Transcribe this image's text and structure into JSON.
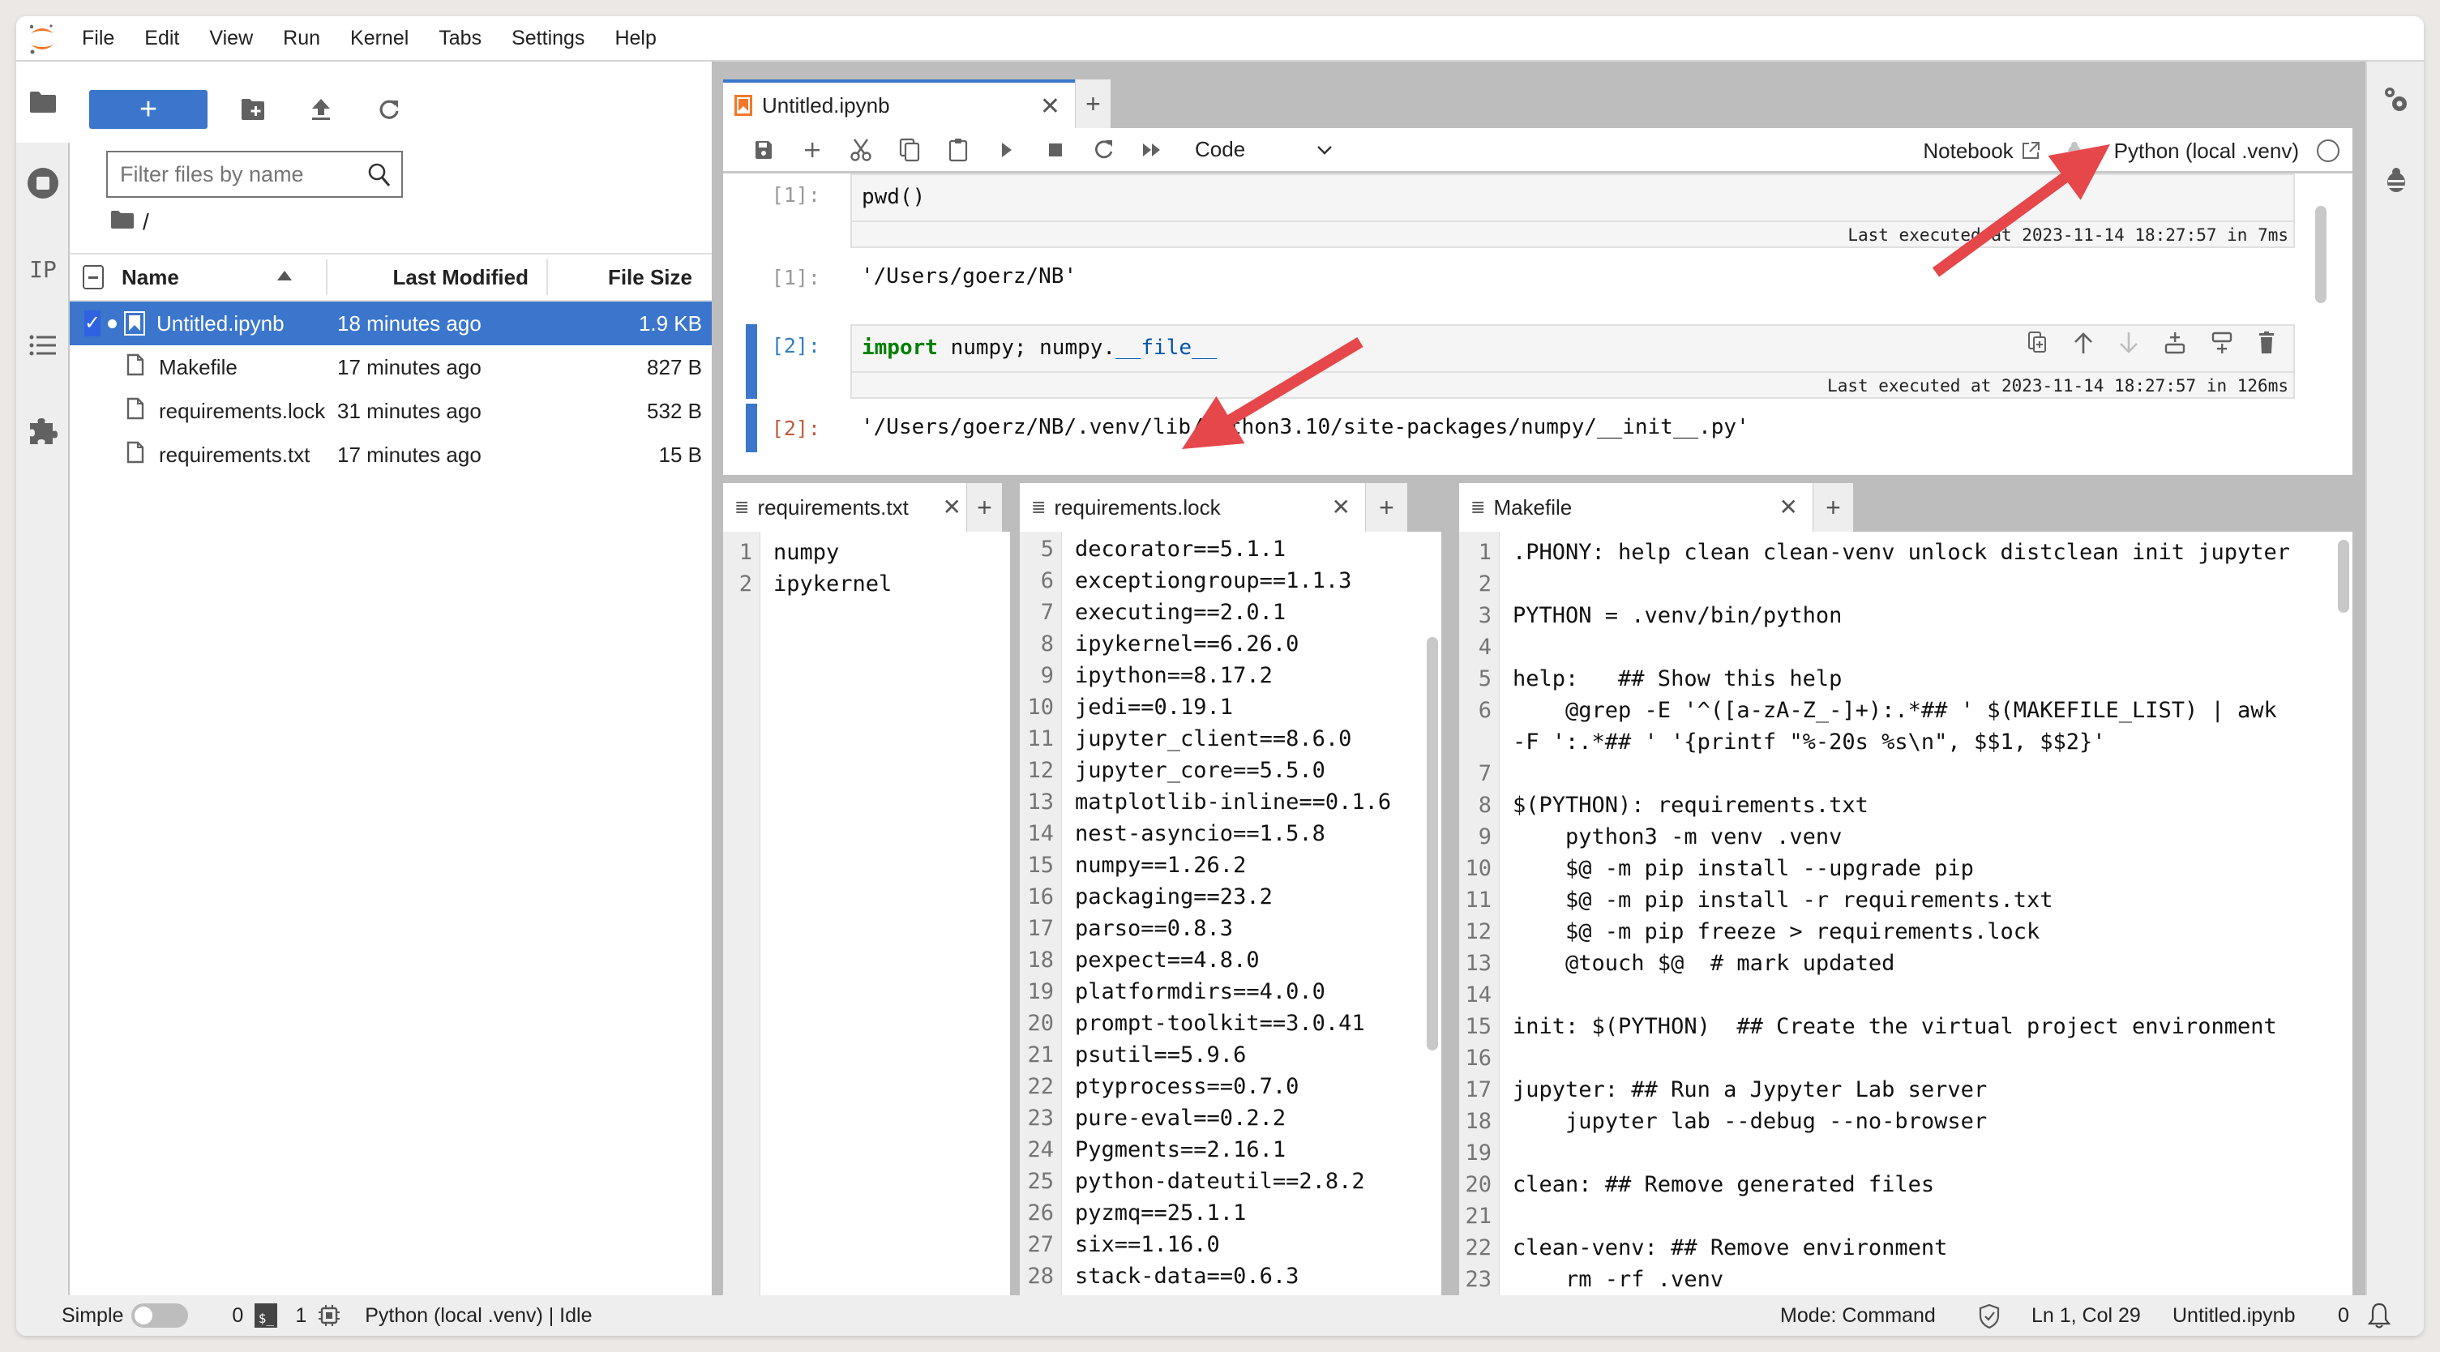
{
  "menubar": {
    "items": [
      "File",
      "Edit",
      "View",
      "Run",
      "Kernel",
      "Tabs",
      "Settings",
      "Help"
    ]
  },
  "left_strip": {
    "items": [
      {
        "name": "file-browser",
        "icon": "folder-icon",
        "active": true
      },
      {
        "name": "running-sessions",
        "icon": "stop-circle-icon"
      },
      {
        "name": "ip-panel",
        "icon": "ip-text-icon",
        "label": "IP"
      },
      {
        "name": "table-of-contents",
        "icon": "list-icon"
      },
      {
        "name": "extensions",
        "icon": "puzzle-icon"
      }
    ]
  },
  "file_browser": {
    "new_button_label": "+",
    "filter_placeholder": "Filter files by name",
    "breadcrumb": "/",
    "columns": {
      "name": "Name",
      "modified": "Last Modified",
      "size": "File Size"
    },
    "files": [
      {
        "name": "Untitled.ipynb",
        "modified": "18 minutes ago",
        "size": "1.9 KB",
        "type": "notebook",
        "selected": true,
        "running": true
      },
      {
        "name": "Makefile",
        "modified": "17 minutes ago",
        "size": "827 B",
        "type": "file"
      },
      {
        "name": "requirements.lock",
        "modified": "31 minutes ago",
        "size": "532 B",
        "type": "file"
      },
      {
        "name": "requirements.txt",
        "modified": "17 minutes ago",
        "size": "15 B",
        "type": "file"
      }
    ]
  },
  "notebook": {
    "tab_label": "Untitled.ipynb",
    "cell_type": "Code",
    "notebook_label": "Notebook",
    "kernel_name": "Python (local .venv)",
    "cells": [
      {
        "in_prompt": "[1]:",
        "code": "pwd()",
        "exec_meta": "Last executed at 2023-11-14 18:27:57 in 7ms",
        "out_prompt": "[1]:",
        "output": "'/Users/goerz/NB'"
      },
      {
        "in_prompt": "[2]:",
        "code_kw": "import",
        "code_mid": " numpy; numpy.",
        "code_attr": "__file__",
        "exec_meta": "Last executed at 2023-11-14 18:27:57 in 126ms",
        "out_prompt": "[2]:",
        "output": "'/Users/goerz/NB/.venv/lib/python3.10/site-packages/numpy/__init__.py'"
      }
    ]
  },
  "editors": {
    "requirements_txt": {
      "tab_label": "requirements.txt",
      "lines": [
        {
          "n": "1",
          "t": "numpy"
        },
        {
          "n": "2",
          "t": "ipykernel"
        }
      ]
    },
    "requirements_lock": {
      "tab_label": "requirements.lock",
      "lines": [
        {
          "n": "5",
          "t": "decorator==5.1.1"
        },
        {
          "n": "6",
          "t": "exceptiongroup==1.1.3"
        },
        {
          "n": "7",
          "t": "executing==2.0.1"
        },
        {
          "n": "8",
          "t": "ipykernel==6.26.0"
        },
        {
          "n": "9",
          "t": "ipython==8.17.2"
        },
        {
          "n": "10",
          "t": "jedi==0.19.1"
        },
        {
          "n": "11",
          "t": "jupyter_client==8.6.0"
        },
        {
          "n": "12",
          "t": "jupyter_core==5.5.0"
        },
        {
          "n": "13",
          "t": "matplotlib-inline==0.1.6"
        },
        {
          "n": "14",
          "t": "nest-asyncio==1.5.8"
        },
        {
          "n": "15",
          "t": "numpy==1.26.2"
        },
        {
          "n": "16",
          "t": "packaging==23.2"
        },
        {
          "n": "17",
          "t": "parso==0.8.3"
        },
        {
          "n": "18",
          "t": "pexpect==4.8.0"
        },
        {
          "n": "19",
          "t": "platformdirs==4.0.0"
        },
        {
          "n": "20",
          "t": "prompt-toolkit==3.0.41"
        },
        {
          "n": "21",
          "t": "psutil==5.9.6"
        },
        {
          "n": "22",
          "t": "ptyprocess==0.7.0"
        },
        {
          "n": "23",
          "t": "pure-eval==0.2.2"
        },
        {
          "n": "24",
          "t": "Pygments==2.16.1"
        },
        {
          "n": "25",
          "t": "python-dateutil==2.8.2"
        },
        {
          "n": "26",
          "t": "pyzmq==25.1.1"
        },
        {
          "n": "27",
          "t": "six==1.16.0"
        },
        {
          "n": "28",
          "t": "stack-data==0.6.3"
        }
      ]
    },
    "makefile": {
      "tab_label": "Makefile",
      "lines": [
        {
          "n": "1",
          "t": ".PHONY: help clean clean-venv unlock distclean init jupyter"
        },
        {
          "n": "2",
          "t": ""
        },
        {
          "n": "3",
          "t": "PYTHON = .venv/bin/python"
        },
        {
          "n": "4",
          "t": ""
        },
        {
          "n": "5",
          "t": "help:   ## Show this help"
        },
        {
          "n": "6",
          "t": "    @grep -E '^([a-zA-Z_-]+):.*## ' $(MAKEFILE_LIST) | awk"
        },
        {
          "n": "",
          "t": "-F ':.*## ' '{printf \"%-20s %s\\n\", $$1, $$2}'"
        },
        {
          "n": "7",
          "t": ""
        },
        {
          "n": "8",
          "t": "$(PYTHON): requirements.txt"
        },
        {
          "n": "9",
          "t": "    python3 -m venv .venv"
        },
        {
          "n": "10",
          "t": "    $@ -m pip install --upgrade pip"
        },
        {
          "n": "11",
          "t": "    $@ -m pip install -r requirements.txt"
        },
        {
          "n": "12",
          "t": "    $@ -m pip freeze > requirements.lock"
        },
        {
          "n": "13",
          "t": "    @touch $@  # mark updated"
        },
        {
          "n": "14",
          "t": ""
        },
        {
          "n": "15",
          "t": "init: $(PYTHON)  ## Create the virtual project environment"
        },
        {
          "n": "16",
          "t": ""
        },
        {
          "n": "17",
          "t": "jupyter: ## Run a Jypyter Lab server"
        },
        {
          "n": "18",
          "t": "    jupyter lab --debug --no-browser"
        },
        {
          "n": "19",
          "t": ""
        },
        {
          "n": "20",
          "t": "clean: ## Remove generated files"
        },
        {
          "n": "21",
          "t": ""
        },
        {
          "n": "22",
          "t": "clean-venv: ## Remove environment"
        },
        {
          "n": "23",
          "t": "    rm -rf .venv"
        }
      ]
    }
  },
  "statusbar": {
    "simple_label": "Simple",
    "simple_enabled": false,
    "terminals_count": "0",
    "terminal_badge": "$_",
    "kernels_count": "1",
    "kernel_status": "Python (local .venv) | Idle",
    "mode": "Mode: Command",
    "cursor_position": "Ln 1, Col 29",
    "active_file": "Untitled.ipynb",
    "notifications_count": "0"
  },
  "annotations": {
    "arrow_color": "#e5474b",
    "arrows": [
      {
        "points_to": "kernel-name"
      },
      {
        "points_to": "cell-output-path"
      }
    ]
  },
  "colors": {
    "accent": "#3b76cc",
    "notebook_icon": "#f37726",
    "keyword": "#008000",
    "out_prompt": "#bf5b3d"
  }
}
